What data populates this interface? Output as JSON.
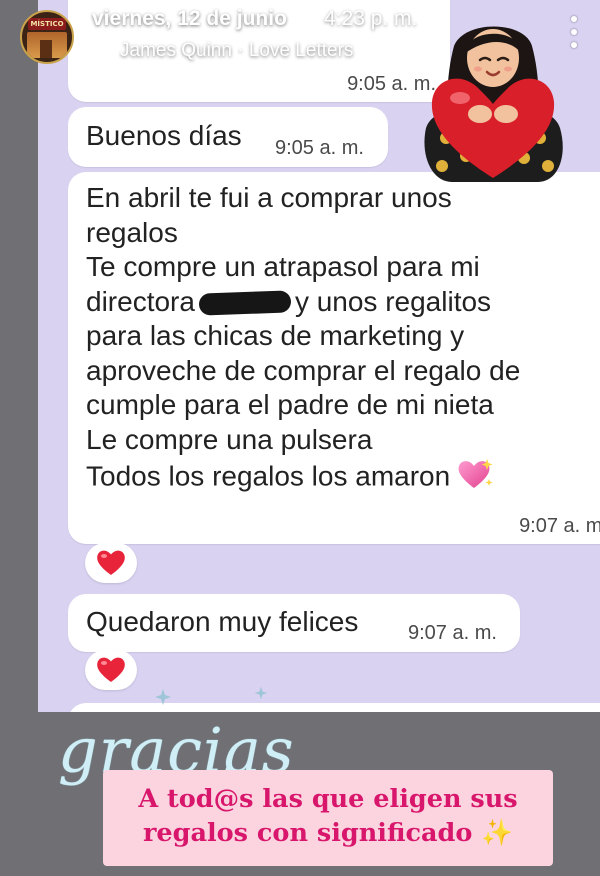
{
  "header": {
    "date": "viernes, 12 de junio",
    "time": "4:23 p. m.",
    "music": "James Quinn · Love Letters",
    "avatar_sign": "MÍSTICO"
  },
  "chat": {
    "messages": [
      {
        "time": "9:05 a. m."
      },
      {
        "text": "Buenos días",
        "time": "9:05 a. m."
      },
      {
        "lines_before": "En abril te fui a comprar unos\nregalos\nTe compre un atrapasol para mi\ndirectora",
        "lines_mid": "y unos regalitos",
        "lines_after": "para las chicas de marketing y\naproveche de comprar el regalo de\ncumple para el padre de mi nieta\nLe compre una pulsera\nTodos los regalos los amaron",
        "time": "9:07 a. m."
      },
      {
        "text": "Quedaron muy felices",
        "time": "9:07 a. m."
      }
    ]
  },
  "stickers": {
    "gracias": "gracias",
    "banner": "A tod@s las que eligen sus\nregalos con significado ✨"
  },
  "colors": {
    "chat_bg": "#d9d2f1",
    "bubble": "#ffffff",
    "banner_bg": "#fbd4df",
    "banner_text": "#d8166c",
    "heart": "#e8243b"
  }
}
